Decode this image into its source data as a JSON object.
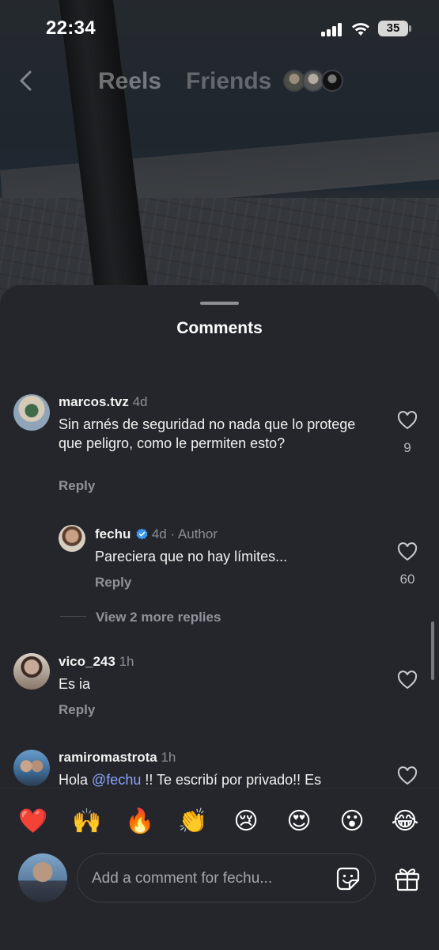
{
  "status": {
    "time": "22:34",
    "battery": "35"
  },
  "header": {
    "tab_reels": "Reels",
    "tab_friends": "Friends"
  },
  "sheet": {
    "title": "Comments"
  },
  "comments": [
    {
      "username": "marcos.tvz",
      "age": "4d",
      "text": "Sin arnés de seguridad no nada que lo protege que peligro, como le permiten esto?",
      "reply": "Reply",
      "likes": "9"
    },
    {
      "username": "fechu",
      "age": "4d",
      "author_tag": "· Author",
      "text": "Pareciera que no hay límites...",
      "reply": "Reply",
      "likes": "60"
    },
    {
      "username": "vico_243",
      "age": "1h",
      "text": "Es ia",
      "reply": "Reply",
      "likes": ""
    },
    {
      "username": "ramiromastrota",
      "age": "1h",
      "text_before": "Hola ",
      "mention": "@fechu",
      "text_after": " !! Te escribí por privado!! Es",
      "likes": ""
    }
  ],
  "view_more": "View 2 more replies",
  "emojis": [
    "❤️",
    "🙌",
    "🔥",
    "👏",
    "😢",
    "😍",
    "😮",
    "😂"
  ],
  "composer": {
    "placeholder": "Add a comment for fechu..."
  },
  "colors": {
    "sheet_bg": "#24262b",
    "verified": "#3897f0",
    "mention": "#8da4ff"
  }
}
